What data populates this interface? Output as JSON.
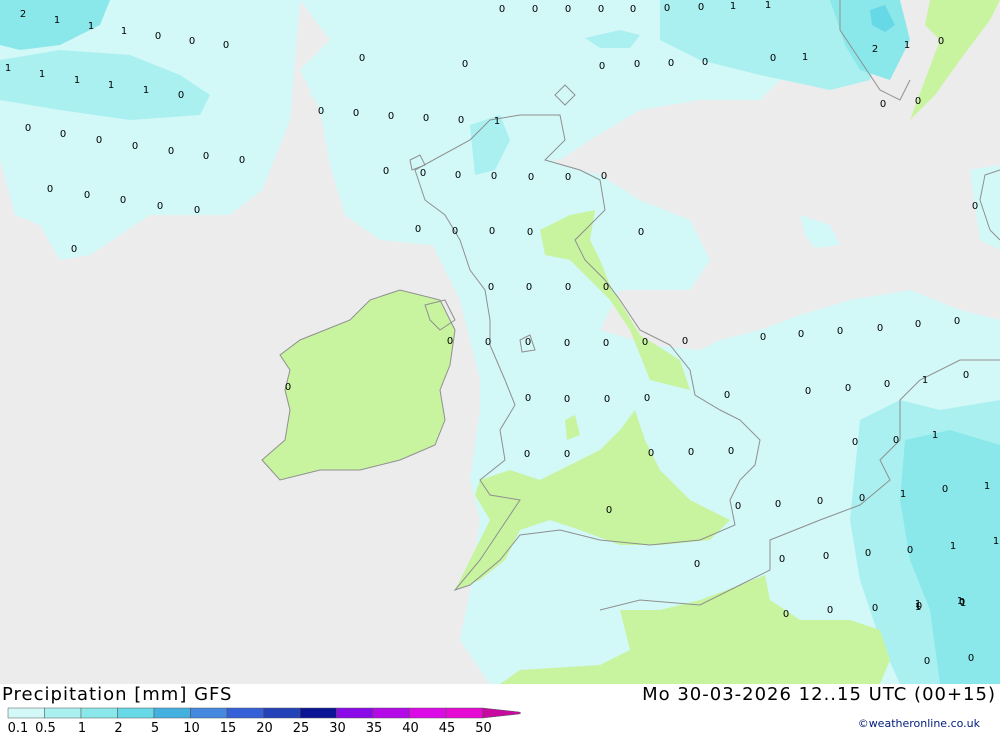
{
  "header": {
    "title": "Precipitation [mm] GFS",
    "datetime": "Mo 30-03-2026 12..15 UTC (00+15)"
  },
  "credit": "©weatheronline.co.uk",
  "legend": {
    "labels": [
      "0.1",
      "0.5",
      "1",
      "2",
      "5",
      "10",
      "15",
      "20",
      "25",
      "30",
      "35",
      "40",
      "45",
      "50"
    ],
    "colors": [
      "#d2f8f8",
      "#aaf0f0",
      "#8ae8ea",
      "#66d8e6",
      "#44b0e0",
      "#4488e0",
      "#3460d8",
      "#2442b8",
      "#0a1494",
      "#8a0ae8",
      "#b40ae8",
      "#dc0ae6",
      "#e60ad2",
      "#c80aa0"
    ]
  },
  "map": {
    "sea_color": "#ececec",
    "land_green": "#c8f4a0",
    "coast_color": "#8f8f8f",
    "values": [
      "2",
      "1",
      "1",
      "1",
      "0",
      "0",
      "0",
      "1",
      "1",
      "1",
      "1",
      "1",
      "0",
      "0",
      "0",
      "0",
      "0",
      "0",
      "0",
      "0",
      "0",
      "0",
      "0",
      "0",
      "0",
      "0",
      "0",
      "0",
      "0",
      "0",
      "0",
      "0",
      "0",
      "1",
      "1",
      "0",
      "0",
      "0",
      "0",
      "0",
      "0",
      "1",
      "0",
      "0",
      "0",
      "0",
      "0",
      "0",
      "1",
      "2",
      "1",
      "0",
      "0",
      "0",
      "0",
      "0",
      "0",
      "0",
      "0",
      "0",
      "0",
      "0",
      "0",
      "0",
      "0",
      "0",
      "0",
      "0",
      "0",
      "0",
      "0",
      "0",
      "0",
      "0",
      "0",
      "0",
      "0",
      "0",
      "0",
      "0",
      "0",
      "0",
      "0",
      "0",
      "0",
      "0",
      "0",
      "0",
      "0",
      "0",
      "0",
      "0",
      "0",
      "0",
      "0",
      "1",
      "0",
      "0",
      "0",
      "0",
      "0",
      "0",
      "0",
      "0",
      "0",
      "1",
      "1",
      "0",
      "0",
      "0",
      "0",
      "0",
      "0",
      "0",
      "0",
      "1",
      "1",
      "1",
      "0",
      "0",
      "0",
      "0",
      "0",
      "1",
      "1",
      "1",
      "1",
      "0",
      "0",
      "0",
      "1",
      "1",
      "1",
      "1"
    ]
  }
}
